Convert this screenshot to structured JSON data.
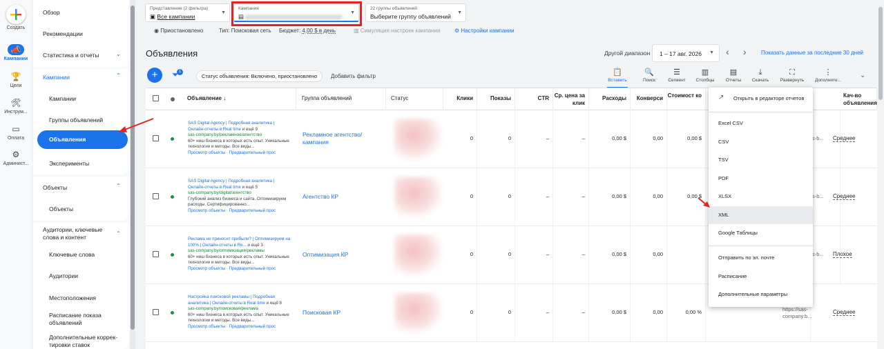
{
  "rail": [
    {
      "name": "create",
      "label": "Создать"
    },
    {
      "name": "campaigns",
      "label": "Кампании"
    },
    {
      "name": "goals",
      "label": "Цели"
    },
    {
      "name": "tools",
      "label": "Инструм..."
    },
    {
      "name": "billing",
      "label": "Оплата"
    },
    {
      "name": "admin",
      "label": "Админист..."
    }
  ],
  "sidebar": {
    "overview": "Обзор",
    "recommendations": "Рекомендации",
    "stats": "Статистика и отчеты",
    "campaigns_header": "Кампании",
    "campaigns": "Кампании",
    "ad_groups": "Группы объявлений",
    "ads": "Объявления",
    "experiments": "Эксперименты",
    "objects_header": "Объекты",
    "objects": "Объекты",
    "audiences_header": "Аудитории, ключевые слова и контент",
    "keywords": "Ключевые слова",
    "audiences": "Аудитории",
    "locations": "Местоположения",
    "schedule": "Расписание показа объявлений",
    "adjustments": "Дополнительные коррек-тировки ставок"
  },
  "topbar": {
    "view_caption": "Представление (2 фильтра)",
    "view_value": "Все кампании",
    "campaign_caption": "Кампания",
    "adgroup_caption": "22 группы объявлений",
    "adgroup_value": "Выберите группу объявлений",
    "status": "Приостановлено",
    "type": "Тип: Поисковая сеть",
    "budget_label": "Бюджет:",
    "budget_value": "4,00 $ в день",
    "simulation": "Симуляция настроек кампании",
    "settings": "Настройки кампании"
  },
  "title": {
    "page": "Объявления",
    "range_label": "Другой диапазон",
    "range_value": "1 – 17 авг. 2026",
    "last30": "Показать данные за последние 30 дней"
  },
  "toolbar": {
    "filter_badge": "1",
    "status_chip": "Статус объявления: Включено, приостановлено",
    "add_filter": "Добавить фильтр",
    "buttons": [
      "Вставить",
      "Поиск",
      "Сегмент",
      "Столбцы",
      "Отчеты",
      "Скачать",
      "Развернуть",
      "Дополните..."
    ]
  },
  "columns": [
    "Объявление",
    "Группа объявлений",
    "Статус",
    "Клики",
    "Показы",
    "CTR",
    "Ср. цена за клик",
    "Расходы",
    "Конверси",
    "Стоимост ко",
    "Кач-во объявления"
  ],
  "rows": [
    {
      "headline": "SAS Digital Agency | Подробная аналитика | Онлайн-отчеты в Real time",
      "more": "и ещё 9",
      "url": "sas-company.by/рекламное/агентство",
      "desc": "60+ ниш бизнеса в которых есть опыт. Уникальные технологии и методы. Все виды...",
      "links": "Просмотр объекты · Предварительный прос",
      "group": "Рекламное агентство/ кампания",
      "clicks": "0",
      "impressions": "0",
      "ctr": "–",
      "cpc": "–",
      "cost": "0,00 $",
      "conv": "0,00",
      "costconv": "0,00 $",
      "url_col": "s-b...",
      "quality": "Среднее"
    },
    {
      "headline": "SAS Digital Agency | Подробная аналитика | Онлайн-отчеты в Real time",
      "more": "и ещё 5",
      "url": "sas-company.by/digital/агентство",
      "desc": "Глубокий анализ бизнеса и сайта. Оптимизируем расходы. Сертифицированно...",
      "links": "Просмотр объекты · Предварительный прос",
      "group": "Агентство КР",
      "clicks": "0",
      "impressions": "0",
      "ctr": "–",
      "cpc": "–",
      "cost": "0,00 $",
      "conv": "0,00",
      "costconv": "0,00 $",
      "url_col": "s-b...",
      "quality": "Среднее"
    },
    {
      "headline": "Реклама не приносит прибыли? | Оптимизируем на 100% | Онлайн-отчеты в Re...",
      "more": "и ещё 3",
      "url": "sas-company.by/оптимизация/рекламы",
      "desc": "60+ ниш бизнеса в которых есть опыт. Уникальные технологии и методы. Все виды...",
      "links": "Просмотр объекты · Предварительный прос",
      "group": "Оптимизация КР",
      "clicks": "0",
      "impressions": "0",
      "ctr": "–",
      "cpc": "–",
      "cost": "0,00 $",
      "conv": "0,00",
      "costconv": "",
      "url_col": "s-b...",
      "quality": "Плохое"
    },
    {
      "headline": "Настройка поисковой рекламы | Подробная аналитика | Онлайн-отчеты в Real time",
      "more": "и ещё 8",
      "url": "sas-company.by/поисковая/реклама",
      "desc": "60+ ниш бизнеса в которых есть опыт. Уникальные технологии и методы. Все виды...",
      "links": "Просмотр объекты · Предварительный прос",
      "group": "Поисковая КР",
      "clicks": "0",
      "impressions": "0",
      "ctr": "–",
      "cpc": "–",
      "cost": "0,00 $",
      "conv": "0,00",
      "costconv": "0,00 %",
      "url_col": "https://sas-company.b...",
      "quality": "Среднее"
    }
  ],
  "menu": {
    "open_editor": "Открыть в редакторе отчетов",
    "formats": [
      "Excel CSV",
      "CSV",
      "TSV",
      "PDF",
      "XLSX",
      "XML",
      "Google Таблицы"
    ],
    "email": "Отправить по эл. почте",
    "schedule": "Расписание",
    "more": "Дополнительные параметры"
  },
  "colors": {
    "accent": "#1a73e8",
    "status_green": "#1e8e3e",
    "annotation_red": "#e52222"
  }
}
